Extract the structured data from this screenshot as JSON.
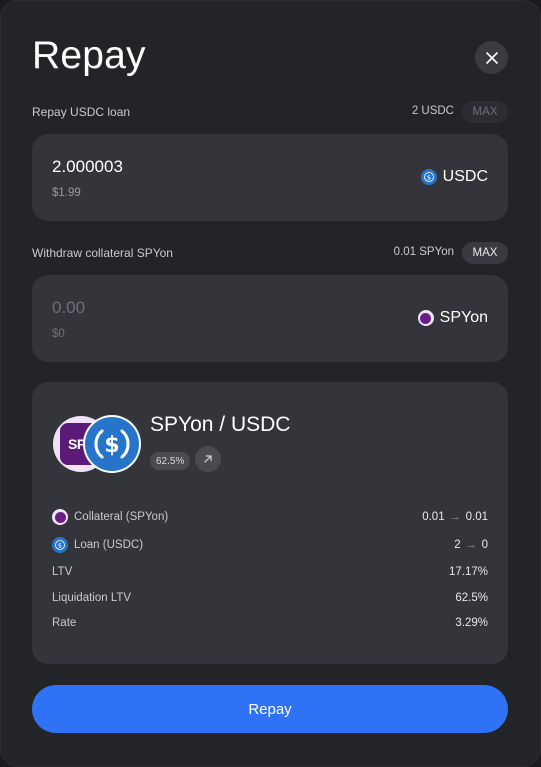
{
  "modal": {
    "title": "Repay",
    "submit_label": "Repay"
  },
  "repay_section": {
    "label": "Repay USDC loan",
    "balance": "2 USDC",
    "max_label": "MAX",
    "amount": "2.000003",
    "usd_value": "$1.99",
    "token": "USDC"
  },
  "withdraw_section": {
    "label": "Withdraw collateral SPYon",
    "balance": "0.01 SPYon",
    "max_label": "MAX",
    "placeholder": "0.00",
    "usd_value": "$0",
    "token": "SPYon"
  },
  "market": {
    "pair": "SPYon / USDC",
    "ltv_badge": "62.5%",
    "collateral_logo_text": "SPY",
    "rows": [
      {
        "label": "Collateral (SPYon)",
        "from": "0.01",
        "to": "0.01"
      },
      {
        "label": "Loan (USDC)",
        "from": "2",
        "to": "0"
      },
      {
        "label": "LTV",
        "value": "17.17%"
      },
      {
        "label": "Liquidation LTV",
        "value": "62.5%"
      },
      {
        "label": "Rate",
        "value": "3.29%"
      }
    ]
  },
  "icons": {
    "close": "close-icon",
    "usdc": "usdc-icon",
    "spyon": "spyon-icon",
    "external_link": "external-link-icon"
  },
  "colors": {
    "accent": "#2f72f5",
    "usdc_blue": "#2775ca",
    "spy_purple": "#5c1a78"
  }
}
